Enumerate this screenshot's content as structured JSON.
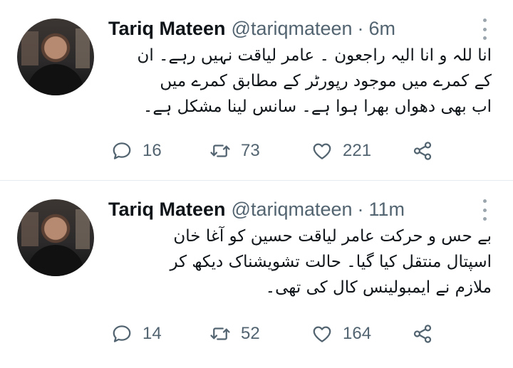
{
  "tweets": [
    {
      "author_name": "Tariq Mateen",
      "handle": "@tariqmateen",
      "separator": "·",
      "time": "6m",
      "text_lines": [
        "انا للہ و انا الیہ راجعون ۔ عامر لیاقت نہیں رہے۔ ان",
        "کے کمرے میں موجود رپورٹر کے مطابق کمرے میں",
        "اب بھی دھواں بھرا ہوا ہے۔ سانس لینا مشکل ہے۔"
      ],
      "replies": "16",
      "retweets": "73",
      "likes": "221"
    },
    {
      "author_name": "Tariq Mateen",
      "handle": "@tariqmateen",
      "separator": "·",
      "time": "11m",
      "text_lines": [
        "بے حس و حرکت عامر لیاقت حسین کو آغا خان",
        "اسپتال منتقل کیا گیا۔ حالت تشویشناک دیکھ کر",
        "ملازم نے ایمبولینس کال کی تھی۔"
      ],
      "replies": "14",
      "retweets": "52",
      "likes": "164"
    }
  ],
  "icons": {
    "reply": "reply-icon",
    "retweet": "retweet-icon",
    "like": "like-icon",
    "share": "share-icon",
    "more": "more-icon"
  },
  "colors": {
    "text": "#0f1419",
    "secondary": "#536471",
    "divider": "#e6ecf0"
  }
}
